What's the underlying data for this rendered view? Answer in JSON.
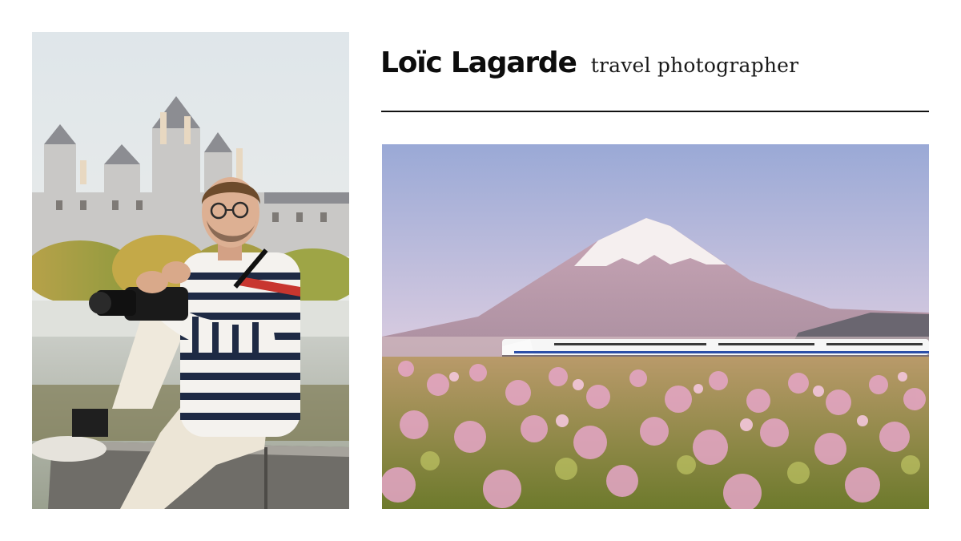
{
  "header": {
    "name": "Loïc Lagarde",
    "role": "travel photographer"
  },
  "photos": {
    "portrait_icon": "photographer-portrait-photo",
    "landscape_icon": "mount-fuji-bullet-train-photo"
  },
  "colors": {
    "text": "#0d0d0d",
    "divider": "#111111",
    "sky_top": "#9aa9d6",
    "sky_bottom": "#f3d9cf",
    "flowers": "#e6a6c8"
  }
}
